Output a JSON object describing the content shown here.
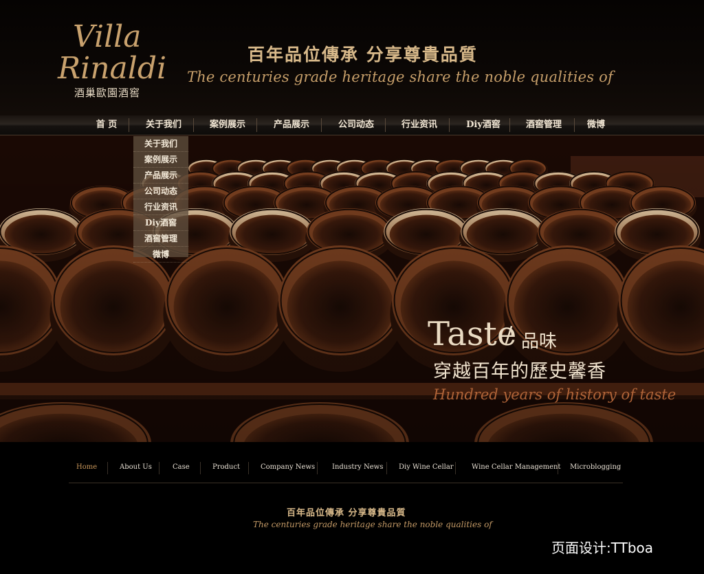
{
  "header": {
    "logo_script": [
      "Villa",
      "Rinaldi"
    ],
    "logo_subtitle": "酒巢歐園酒窖",
    "slogan_cn": "百年品位傳承 分享尊貴品質",
    "slogan_en": "The centuries grade heritage share the noble qualities of"
  },
  "main_nav": {
    "items": [
      "首 页",
      "关于我们",
      "案例展示",
      "产品展示",
      "公司动态",
      "行业资讯",
      "Diy酒窖",
      "酒窖管理",
      "微博"
    ]
  },
  "dropdown": {
    "items": [
      "关于我们",
      "案例展示",
      "产品展示",
      "公司动态",
      "行业资讯",
      "Diy酒窖",
      "酒窖管理",
      "微博"
    ]
  },
  "hero": {
    "taste_en": "Taste",
    "taste_slash": "/",
    "taste_cn": "品味",
    "line2": "穿越百年的歷史馨香",
    "line3": "Hundred years of history of taste"
  },
  "footer_nav": {
    "items": [
      "Home",
      "About Us",
      "Case",
      "Product",
      "Company News",
      "Industry News",
      "Diy Wine Cellar",
      "Wine Cellar Management",
      "Microblogging"
    ]
  },
  "footer": {
    "slogan_cn": "百年品位傳承 分享尊貴品質",
    "slogan_en": "The centuries grade heritage share the noble qualities of",
    "designer": "页面设计:TTboa"
  },
  "colors": {
    "gold": "#d8b98a",
    "copper": "#b06438",
    "background": "#000000"
  }
}
